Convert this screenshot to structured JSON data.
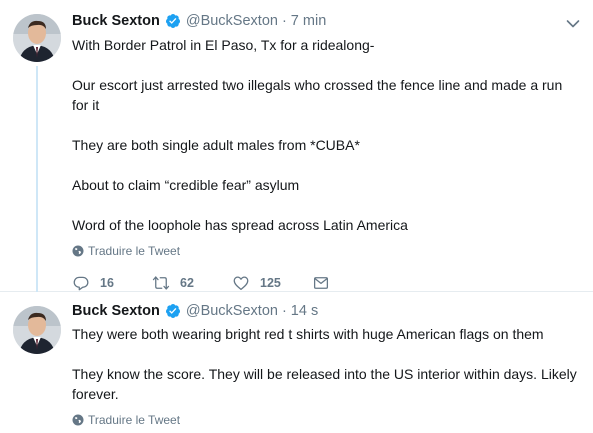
{
  "tweets": [
    {
      "author_name": "Buck Sexton",
      "handle": "@BuckSexton",
      "separator": "·",
      "time": "7 min",
      "paragraphs": [
        "With Border Patrol in El Paso, Tx for a ridealong-",
        "Our escort just arrested two illegals who crossed the fence line and made a run for it",
        "They are both single adult males from *CUBA*",
        "About to claim “credible fear” asylum",
        "Word of the loophole has spread across Latin America"
      ],
      "translate_label": "Traduire le Tweet",
      "reply_count": "16",
      "retweet_count": "62",
      "like_count": "125"
    },
    {
      "author_name": "Buck Sexton",
      "handle": "@BuckSexton",
      "separator": "·",
      "time": "14 s",
      "paragraphs": [
        "They were both wearing bright red t shirts with huge American flags on them",
        "They know the score. They will be released into the US interior within days. Likely forever."
      ],
      "translate_label": "Traduire le Tweet"
    }
  ],
  "colors": {
    "accent": "#1da1f2",
    "secondary_text": "#657786",
    "thread_line": "#cfe7f7",
    "divider": "#e6ecf0"
  },
  "icons": {
    "verified": "verified-badge-icon",
    "more": "chevron-down-icon",
    "translate": "globe-icon",
    "reply": "reply-icon",
    "retweet": "retweet-icon",
    "like": "heart-icon",
    "dm": "envelope-icon"
  }
}
